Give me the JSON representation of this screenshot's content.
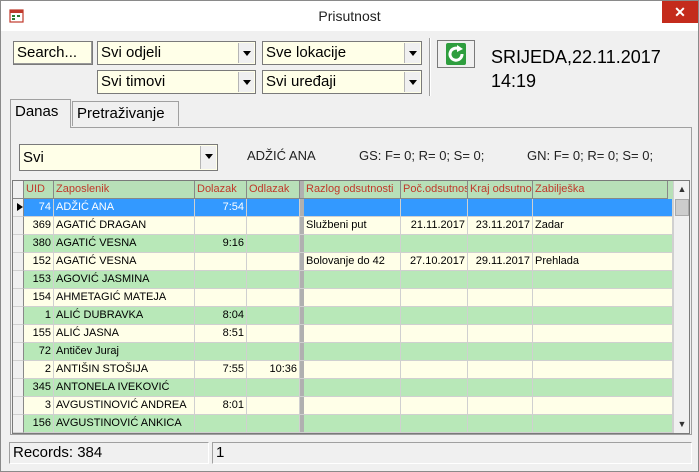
{
  "window": {
    "title": "Prisutnost",
    "close_glyph": "✕"
  },
  "toolbar": {
    "search_label": "Search...",
    "department": "Svi odjeli",
    "location": "Sve lokacije",
    "team": "Svi timovi",
    "device": "Svi uređaji",
    "refresh_icon": "refresh-icon"
  },
  "datetime": {
    "date": "SRIJEDA,22.11.2017",
    "time": "14:19"
  },
  "tabs": [
    {
      "label": "Danas"
    },
    {
      "label": "Pretraživanje"
    }
  ],
  "filter": {
    "selected": "Svi",
    "employee": "ADŽIĆ ANA",
    "gs": "GS: F= 0; R= 0; S= 0;",
    "gn": "GN: F= 0; R= 0; S= 0;"
  },
  "grid": {
    "columns": [
      "UID",
      "Zaposlenik",
      "Dolazak",
      "Odlazak",
      "Razlog odsutnosti",
      "Poč.odsutnosti",
      "Kraj odsutnosti",
      "Zabilješka"
    ],
    "rows": [
      {
        "uid": "74",
        "name": "ADŽIĆ ANA",
        "in": "7:54",
        "out": "",
        "reason": "",
        "start": "",
        "end": "",
        "note": ""
      },
      {
        "uid": "369",
        "name": "AGATIĆ DRAGAN",
        "in": "",
        "out": "",
        "reason": "Službeni put",
        "start": "21.11.2017",
        "end": "23.11.2017",
        "note": "Zadar"
      },
      {
        "uid": "380",
        "name": "AGATIĆ VESNA",
        "in": "9:16",
        "out": "",
        "reason": "",
        "start": "",
        "end": "",
        "note": ""
      },
      {
        "uid": "152",
        "name": "AGATIĆ VESNA",
        "in": "",
        "out": "",
        "reason": "Bolovanje do 42",
        "start": "27.10.2017",
        "end": "29.11.2017",
        "note": "Prehlada"
      },
      {
        "uid": "153",
        "name": "AGOVIĆ JASMINA",
        "in": "",
        "out": "",
        "reason": "",
        "start": "",
        "end": "",
        "note": ""
      },
      {
        "uid": "154",
        "name": "AHMETAGIĆ MATEJA",
        "in": "",
        "out": "",
        "reason": "",
        "start": "",
        "end": "",
        "note": ""
      },
      {
        "uid": "1",
        "name": "ALIĆ DUBRAVKA",
        "in": "8:04",
        "out": "",
        "reason": "",
        "start": "",
        "end": "",
        "note": ""
      },
      {
        "uid": "155",
        "name": "ALIĆ JASNA",
        "in": "8:51",
        "out": "",
        "reason": "",
        "start": "",
        "end": "",
        "note": ""
      },
      {
        "uid": "72",
        "name": "Antičev Juraj",
        "in": "",
        "out": "",
        "reason": "",
        "start": "",
        "end": "",
        "note": ""
      },
      {
        "uid": "2",
        "name": "ANTIŠIN STOŠIJA",
        "in": "7:55",
        "out": "10:36",
        "reason": "",
        "start": "",
        "end": "",
        "note": ""
      },
      {
        "uid": "345",
        "name": "ANTONELA IVEKOVIĆ",
        "in": "",
        "out": "",
        "reason": "",
        "start": "",
        "end": "",
        "note": ""
      },
      {
        "uid": "3",
        "name": "AVGUSTINOVIĆ ANDREA",
        "in": "8:01",
        "out": "",
        "reason": "",
        "start": "",
        "end": "",
        "note": ""
      },
      {
        "uid": "156",
        "name": "AVGUSTINOVIĆ ANKICA",
        "in": "",
        "out": "",
        "reason": "",
        "start": "",
        "end": "",
        "note": ""
      }
    ],
    "selected_row": 0,
    "colors": {
      "selected": "#3399ff",
      "green": "#b8e8b8",
      "yellow": "#ffffe8",
      "header": "#b8e0b8",
      "header_text": "#c0392b"
    }
  },
  "status": {
    "records": "Records: 384",
    "page": "1"
  }
}
